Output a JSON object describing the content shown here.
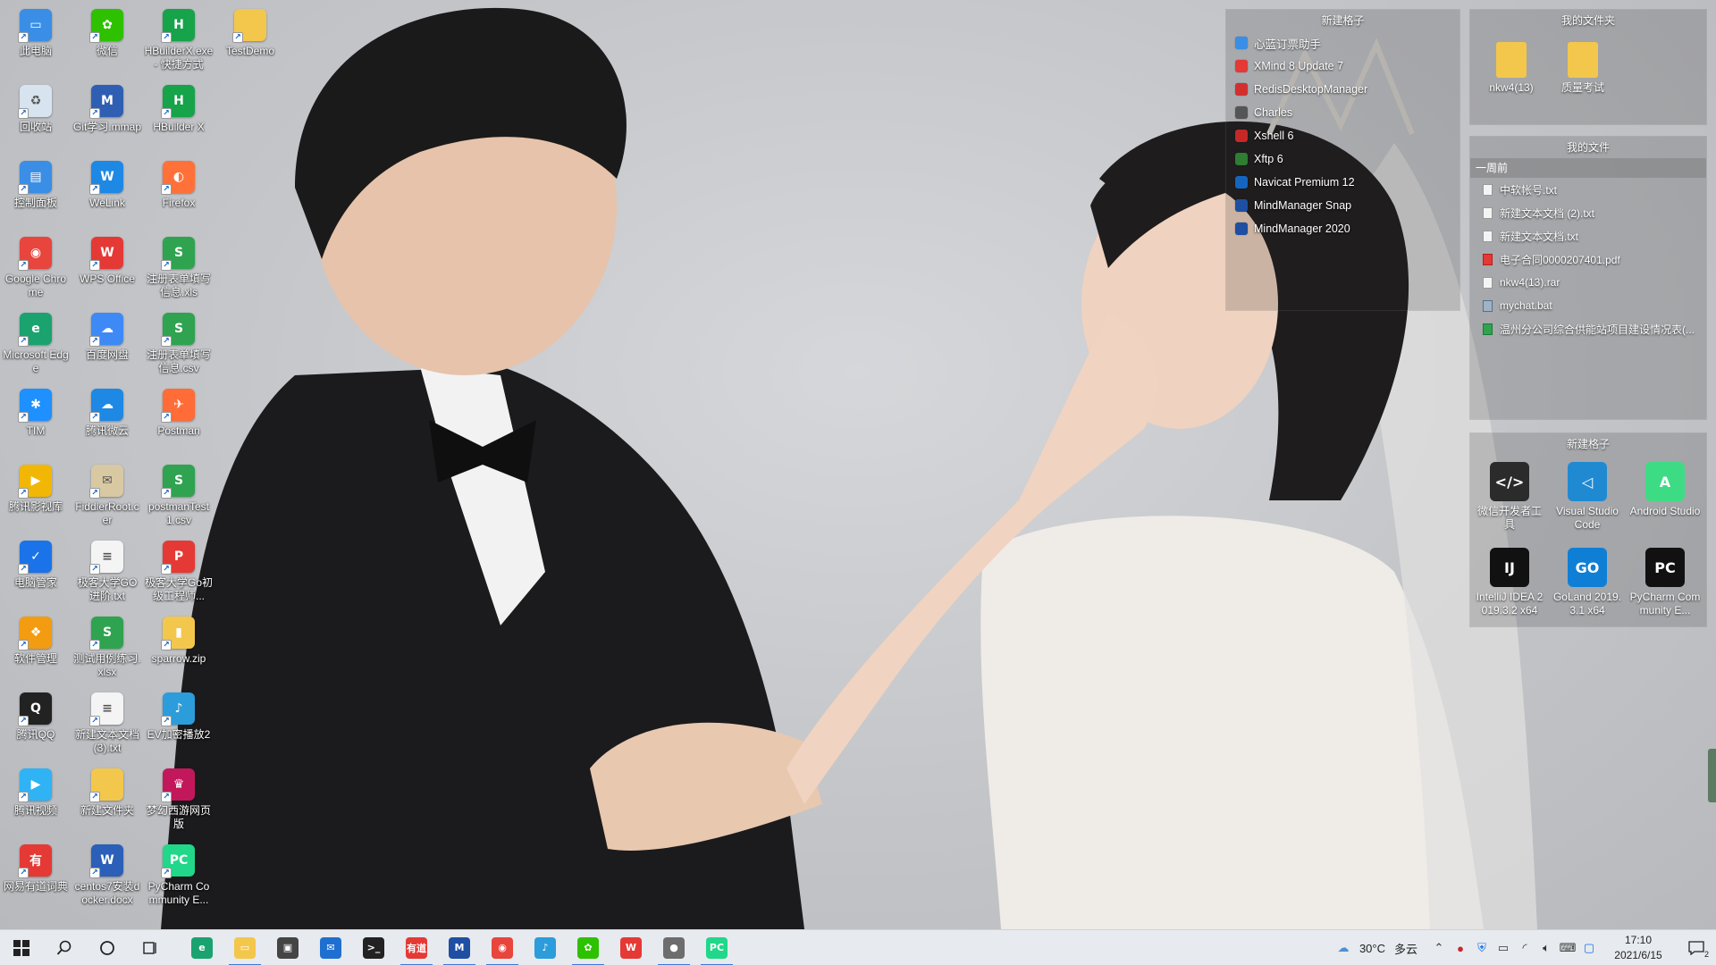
{
  "desktop_icons": [
    {
      "label": "此电脑",
      "icon": "computer-icon",
      "color": "#3a8ee6"
    },
    {
      "label": "回收站",
      "icon": "recycle-bin-icon",
      "color": "#d7e3ee"
    },
    {
      "label": "控制面板",
      "icon": "control-panel-icon",
      "color": "#3a8ee6"
    },
    {
      "label": "Google Chrome",
      "icon": "chrome-icon",
      "color": "#e8453c"
    },
    {
      "label": "Microsoft Edge",
      "icon": "edge-icon",
      "color": "#1aa36f"
    },
    {
      "label": "TIM",
      "icon": "tim-icon",
      "color": "#1e90ff"
    },
    {
      "label": "腾讯影视库",
      "icon": "video-library-icon",
      "color": "#f2b705"
    },
    {
      "label": "电脑管家",
      "icon": "pc-manager-icon",
      "color": "#1a73e8"
    },
    {
      "label": "软件管理",
      "icon": "software-manager-icon",
      "color": "#f39c12"
    },
    {
      "label": "腾讯QQ",
      "icon": "qq-icon",
      "color": "#222222"
    },
    {
      "label": "腾讯视频",
      "icon": "tencent-video-icon",
      "color": "#2fb3f5"
    },
    {
      "label": "网易有道词典",
      "icon": "youdao-icon",
      "color": "#e53935"
    },
    {
      "label": "微信",
      "icon": "wechat-icon",
      "color": "#2dc100"
    },
    {
      "label": "Git学习.mmap",
      "icon": "mindmanager-file-icon",
      "color": "#2f5fb3"
    },
    {
      "label": "WeLink",
      "icon": "welink-icon",
      "color": "#1e88e5"
    },
    {
      "label": "WPS Office",
      "icon": "wps-icon",
      "color": "#e53935"
    },
    {
      "label": "百度网盘",
      "icon": "baidu-netdisk-icon",
      "color": "#3d8af7"
    },
    {
      "label": "腾讯微云",
      "icon": "weiyun-icon",
      "color": "#1e88e5"
    },
    {
      "label": "FiddlerRoot.cer",
      "icon": "certificate-icon",
      "color": "#d8c9a3"
    },
    {
      "label": "极客大学GO进阶.txt",
      "icon": "text-file-icon",
      "color": "#f4f4f4"
    },
    {
      "label": "测试用例练习.xlsx",
      "icon": "excel-file-icon",
      "color": "#2fa34f"
    },
    {
      "label": "新建文本文档 (3).txt",
      "icon": "text-file-icon",
      "color": "#f4f4f4"
    },
    {
      "label": "新建文件夹",
      "icon": "folder-icon",
      "color": "#f3c74c"
    },
    {
      "label": "centos7安装docker.docx",
      "icon": "word-file-icon",
      "color": "#2b5fb8"
    },
    {
      "label": "HBuilderX.exe - 快捷方式",
      "icon": "hbuilderx-icon",
      "color": "#16a34a"
    },
    {
      "label": "HBuilder X",
      "icon": "hbuilderx-icon",
      "color": "#16a34a"
    },
    {
      "label": "Firefox",
      "icon": "firefox-icon",
      "color": "#ff7139"
    },
    {
      "label": "注册表单填写信息.xls",
      "icon": "excel-file-icon",
      "color": "#2fa34f"
    },
    {
      "label": "注册表单填写信息.csv",
      "icon": "excel-file-icon",
      "color": "#2fa34f"
    },
    {
      "label": "Postman",
      "icon": "postman-icon",
      "color": "#ff6c37"
    },
    {
      "label": "postmanTest1.csv",
      "icon": "excel-file-icon",
      "color": "#2fa34f"
    },
    {
      "label": "极客大学Go初级工程师...",
      "icon": "pdf-file-icon",
      "color": "#e53935"
    },
    {
      "label": "sparrow.zip",
      "icon": "zip-file-icon",
      "color": "#f3c74c"
    },
    {
      "label": "EV加密播放2",
      "icon": "ev-player-icon",
      "color": "#2c9cdb"
    },
    {
      "label": "梦幻西游网页版",
      "icon": "game-icon",
      "color": "#c2185b"
    },
    {
      "label": "PyCharm Community E...",
      "icon": "pycharm-icon",
      "color": "#21d789"
    },
    {
      "label": "TestDemo",
      "icon": "folder-icon",
      "color": "#f3c74c"
    }
  ],
  "fence_apps": {
    "title": "新建格子",
    "items": [
      {
        "label": "心蓝订票助手",
        "color": "#3a8ee6"
      },
      {
        "label": "XMind 8 Update 7",
        "color": "#e53935"
      },
      {
        "label": "RedisDesktopManager",
        "color": "#d32f2f"
      },
      {
        "label": "Charles",
        "color": "#555555"
      },
      {
        "label": "Xshell 6",
        "color": "#c62828"
      },
      {
        "label": "Xftp 6",
        "color": "#2e7d32"
      },
      {
        "label": "Navicat Premium 12",
        "color": "#1565c0"
      },
      {
        "label": "MindManager Snap",
        "color": "#1e4fa3"
      },
      {
        "label": "MindManager 2020",
        "color": "#1e4fa3"
      }
    ]
  },
  "fence_folders": {
    "title": "我的文件夹",
    "items": [
      {
        "label": "nkw4(13)",
        "icon": "folder-icon",
        "color": "#f3c74c"
      },
      {
        "label": "质量考试",
        "icon": "folder-icon",
        "color": "#f3c74c"
      }
    ]
  },
  "fence_files": {
    "title": "我的文件",
    "section": "一周前",
    "items": [
      {
        "label": "中软帐号.txt",
        "kind": "txt"
      },
      {
        "label": "新建文本文档 (2).txt",
        "kind": "txt"
      },
      {
        "label": "新建文本文档.txt",
        "kind": "txt"
      },
      {
        "label": "电子合同0000207401.pdf",
        "kind": "pdf"
      },
      {
        "label": "nkw4(13).rar",
        "kind": "txt"
      },
      {
        "label": "mychat.bat",
        "kind": "bat"
      },
      {
        "label": "温州分公司综合供能站项目建设情况表(...",
        "kind": "xls"
      }
    ]
  },
  "fence_dev": {
    "title": "新建格子",
    "items": [
      {
        "label": "微信开发者工具",
        "glyph": "</>",
        "color": "#2b2b2b"
      },
      {
        "label": "Visual Studio Code",
        "glyph": "◁",
        "color": "#1f8ad2"
      },
      {
        "label": "Android Studio",
        "glyph": "A",
        "color": "#3ddc84"
      },
      {
        "label": "IntelliJ IDEA 2019.3.2 x64",
        "glyph": "IJ",
        "color": "#111111"
      },
      {
        "label": "GoLand 2019.3.1 x64",
        "glyph": "GO",
        "color": "#0f7fd6"
      },
      {
        "label": "PyCharm Community E...",
        "glyph": "PC",
        "color": "#111111"
      }
    ]
  },
  "taskbar": {
    "start_icon": "windows-start-icon",
    "search_icon": "search-icon",
    "cortana_icon": "cortana-icon",
    "taskview_icon": "task-view-icon",
    "apps": [
      {
        "name": "edge",
        "glyph": "e",
        "color": "#1aa36f",
        "running": false
      },
      {
        "name": "file-explorer",
        "glyph": "▭",
        "color": "#f3c74c",
        "running": true
      },
      {
        "name": "store",
        "glyph": "▣",
        "color": "#444444",
        "running": false
      },
      {
        "name": "mail",
        "glyph": "✉",
        "color": "#1f6fd1",
        "running": false
      },
      {
        "name": "terminal",
        "glyph": ">_",
        "color": "#222222",
        "running": false
      },
      {
        "name": "youdao",
        "glyph": "有道",
        "color": "#e53935",
        "running": true
      },
      {
        "name": "mindmanager",
        "glyph": "M",
        "color": "#1e4fa3",
        "running": true
      },
      {
        "name": "chrome",
        "glyph": "◉",
        "color": "#e8453c",
        "running": true
      },
      {
        "name": "ev-player",
        "glyph": "♪",
        "color": "#2c9cdb",
        "running": false
      },
      {
        "name": "wechat",
        "glyph": "✿",
        "color": "#2dc100",
        "running": true
      },
      {
        "name": "wps",
        "glyph": "W",
        "color": "#e53935",
        "running": false
      },
      {
        "name": "photos",
        "glyph": "●",
        "color": "#6d6d6d",
        "running": true
      },
      {
        "name": "pycharm",
        "glyph": "PC",
        "color": "#21d789",
        "running": true
      }
    ],
    "weather_temp": "30°C",
    "weather_desc": "多云",
    "time": "17:10",
    "date": "2021/6/15",
    "notification_count": "2"
  }
}
